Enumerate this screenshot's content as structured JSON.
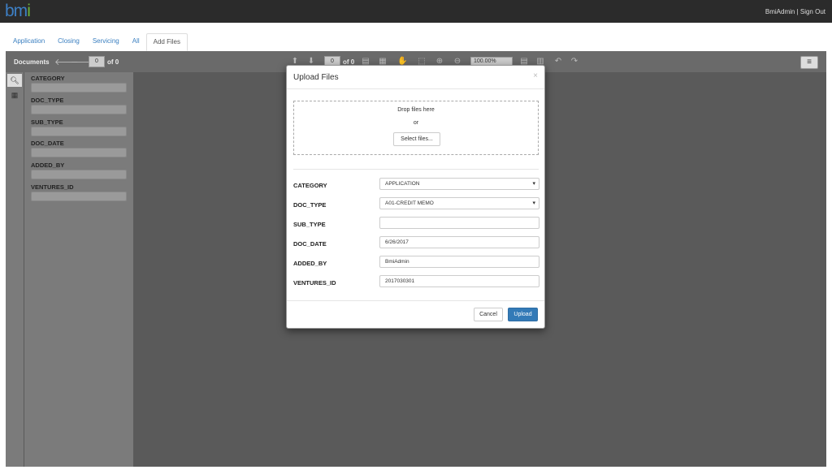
{
  "header": {
    "logo_part1": "bm",
    "logo_part2": "i",
    "user": "BmiAdmin",
    "separator": " | ",
    "signout": "Sign Out"
  },
  "tabs": [
    {
      "label": "Application"
    },
    {
      "label": "Closing"
    },
    {
      "label": "Servicing"
    },
    {
      "label": "All"
    },
    {
      "label": "Add Files"
    }
  ],
  "toolbar": {
    "documents_label": "Documents",
    "doc_page": "0",
    "doc_of": "of 0",
    "page": "0",
    "page_of": "of 0",
    "zoom": "100.00%"
  },
  "filters": [
    {
      "label": "CATEGORY"
    },
    {
      "label": "DOC_TYPE"
    },
    {
      "label": "SUB_TYPE"
    },
    {
      "label": "DOC_DATE"
    },
    {
      "label": "ADDED_BY"
    },
    {
      "label": "VENTURES_ID"
    }
  ],
  "modal": {
    "title": "Upload Files",
    "close": "×",
    "drop_text": "Drop files here",
    "or_text": "or",
    "select_files": "Select files...",
    "fields": [
      {
        "label": "CATEGORY",
        "value": "APPLICATION"
      },
      {
        "label": "DOC_TYPE",
        "value": "A01-CREDIT MEMO"
      },
      {
        "label": "SUB_TYPE",
        "value": ""
      },
      {
        "label": "DOC_DATE",
        "value": "6/26/2017"
      },
      {
        "label": "ADDED_BY",
        "value": "BmiAdmin"
      },
      {
        "label": "VENTURES_ID",
        "value": "2017030301"
      }
    ],
    "cancel": "Cancel",
    "upload": "Upload"
  }
}
